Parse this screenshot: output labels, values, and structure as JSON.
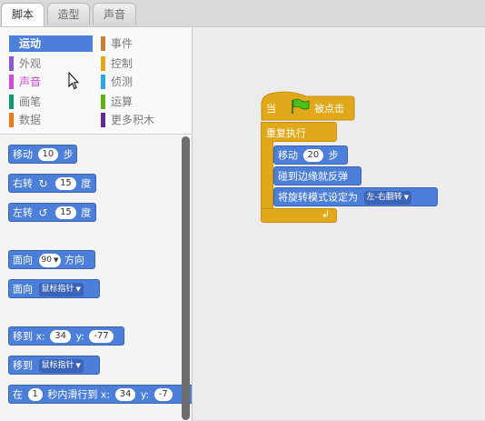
{
  "tabs": [
    "脚本",
    "造型",
    "声音"
  ],
  "categories": {
    "left": [
      {
        "label": "运动",
        "color": "#4c7fd9"
      },
      {
        "label": "外观",
        "color": "#8a55d7"
      },
      {
        "label": "声音",
        "color": "#cf4ad9"
      },
      {
        "label": "画笔",
        "color": "#0e9a6c"
      },
      {
        "label": "数据",
        "color": "#ee7d16"
      }
    ],
    "right": [
      {
        "label": "事件",
        "color": "#c88330"
      },
      {
        "label": "控制",
        "color": "#e1a91a"
      },
      {
        "label": "侦测",
        "color": "#2ca5e2"
      },
      {
        "label": "运算",
        "color": "#5cb712"
      },
      {
        "label": "更多积木",
        "color": "#632d99"
      }
    ]
  },
  "palette": {
    "move": {
      "label": "移动",
      "value": "10",
      "suffix": "步"
    },
    "turn_right": {
      "label": "右转",
      "value": "15",
      "suffix": "度"
    },
    "turn_left": {
      "label": "左转",
      "value": "15",
      "suffix": "度"
    },
    "point_direction": {
      "label": "面向",
      "value": "90",
      "suffix": "方向"
    },
    "point_towards": {
      "label": "面向",
      "option": "鼠标指针"
    },
    "goto_xy": {
      "label": "移到 x:",
      "x": "34",
      "ylabel": "y:",
      "y": "-77"
    },
    "goto": {
      "label": "移到",
      "option": "鼠标指针"
    },
    "glide": {
      "label": "在",
      "secs": "1",
      "mid": "秒内滑行到 x:",
      "x": "34",
      "ylabel": "y:",
      "y": "-7"
    }
  },
  "script": {
    "hat_prefix": "当",
    "hat_suffix": "被点击",
    "forever": "重复执行",
    "move": {
      "label": "移动",
      "value": "20",
      "suffix": "步"
    },
    "bounce": "碰到边缘就反弹",
    "rotation": {
      "label": "将旋转模式设定为",
      "option": "左-右翻转"
    }
  }
}
